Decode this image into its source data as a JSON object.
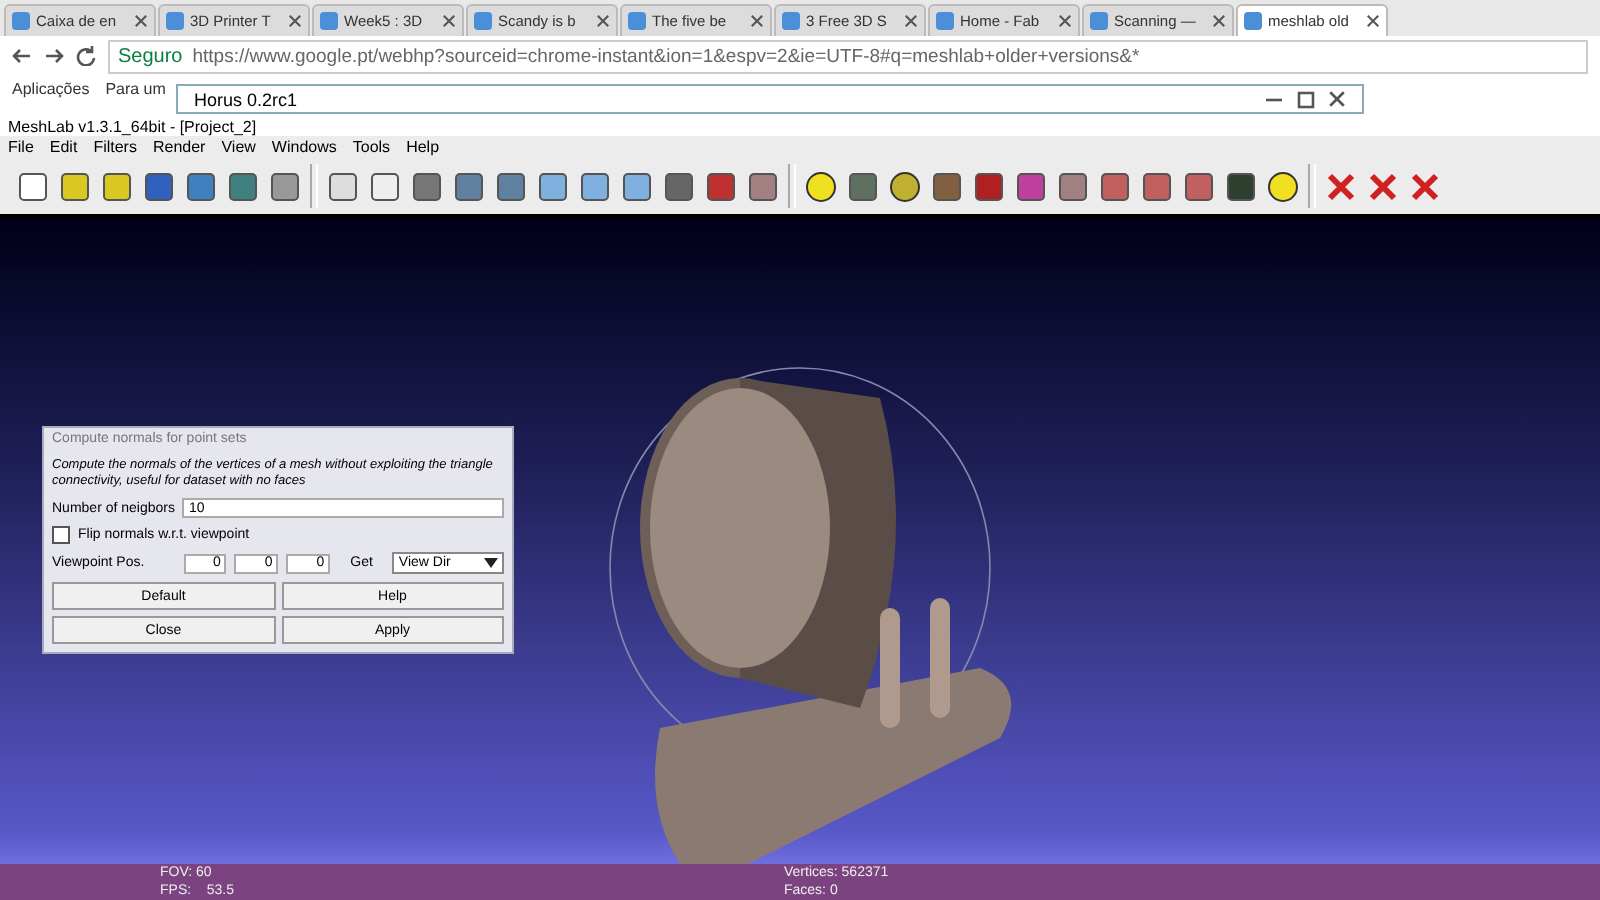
{
  "browser": {
    "tabs": [
      {
        "label": "Caixa de en",
        "selected": false
      },
      {
        "label": "3D Printer T",
        "selected": false
      },
      {
        "label": "Week5 : 3D",
        "selected": false
      },
      {
        "label": "Scandy is b",
        "selected": false
      },
      {
        "label": "The five be",
        "selected": false
      },
      {
        "label": "3 Free 3D S",
        "selected": false
      },
      {
        "label": "Home - Fab",
        "selected": false
      },
      {
        "label": "Scanning —",
        "selected": false
      },
      {
        "label": "meshlab old",
        "selected": true
      }
    ],
    "secure_label": "Seguro",
    "url": "https://www.google.pt/webhp?sourceid=chrome-instant&ion=1&espv=2&ie=UTF-8#q=meshlab+older+versions&*",
    "bookmarks": [
      "Aplicações",
      "Para um"
    ]
  },
  "horus_window": {
    "title": "Horus 0.2rc1"
  },
  "meshlab": {
    "title": "MeshLab v1.3.1_64bit - [Project_2]",
    "menu": [
      "File",
      "Edit",
      "Filters",
      "Render",
      "View",
      "Windows",
      "Tools",
      "Help"
    ],
    "dialog": {
      "title": "Compute normals for point sets",
      "description": "Compute the normals of the vertices of a mesh without exploiting the triangle connectivity, useful for dataset with no faces",
      "neighbors_label": "Number of neigbors",
      "neighbors_value": "10",
      "flip_label": "Flip normals w.r.t. viewpoint",
      "flip_checked": false,
      "viewpoint_label": "Viewpoint Pos.",
      "viewpoint_values": [
        "0",
        "0",
        "0"
      ],
      "get_label": "Get",
      "get_select": "View Dir",
      "buttons": [
        "Default",
        "Help",
        "Close",
        "Apply"
      ]
    },
    "status": {
      "left": [
        "FOV: 60",
        "FPS:    53.5"
      ],
      "right": [
        "Vertices: 562371",
        "Faces: 0"
      ]
    }
  }
}
